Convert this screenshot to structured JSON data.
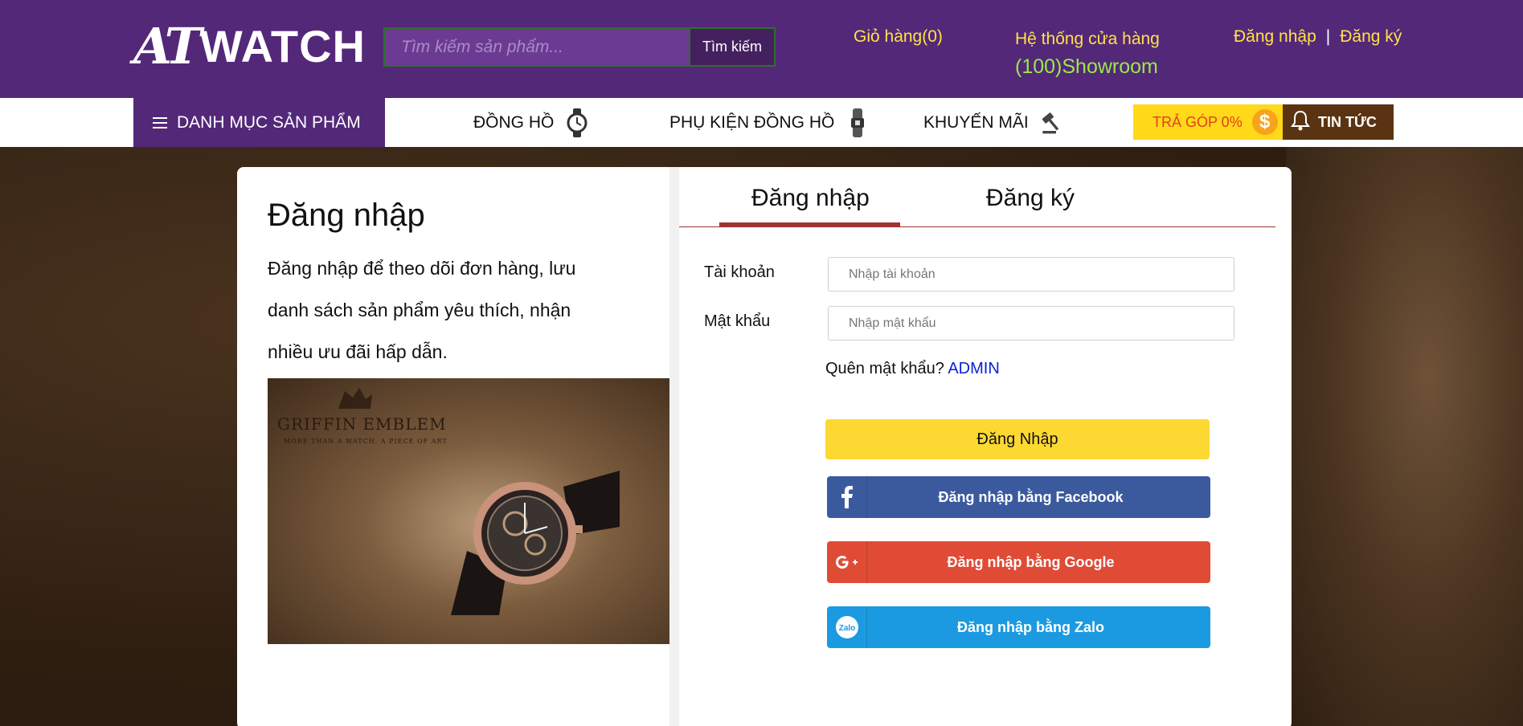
{
  "header": {
    "logo_mark": "AT",
    "logo_text": "WATCH",
    "search_placeholder": "Tìm kiếm sản phẩm...",
    "search_button": "Tìm kiếm",
    "cart": "Giỏ hàng(0)",
    "stores_label": "Hệ thống cửa hàng",
    "stores_count": "(100)Showroom",
    "login_link": "Đăng nhập",
    "separator": "|",
    "register_link": "Đăng ký"
  },
  "nav": {
    "category_menu": "DANH MỤC SẢN PHẨM",
    "items": [
      {
        "label": "ĐỒNG HỒ",
        "icon": "watch-icon"
      },
      {
        "label": "PHỤ KIỆN ĐỒNG HỒ",
        "icon": "watch-strap-icon"
      },
      {
        "label": "KHUYẾN MÃI",
        "icon": "gavel-icon"
      }
    ],
    "installment": "TRẢ GÓP 0%",
    "installment_icon": "dollar-coin-icon",
    "news": "TIN TỨC",
    "news_icon": "bell-icon"
  },
  "left": {
    "title": "Đăng nhập",
    "description": "Đăng nhập để theo dõi đơn hàng, lưu danh sách sản phẩm yêu thích, nhận nhiều ưu đãi hấp dẫn.",
    "image_brand": "GRIFFIN EMBLEM",
    "image_tagline": "MORE THAN A WATCH. A PIECE OF ART"
  },
  "form": {
    "tab_login": "Đăng nhập",
    "tab_register": "Đăng ký",
    "account_label": "Tài khoản",
    "account_placeholder": "Nhập tài khoản",
    "password_label": "Mật khẩu",
    "password_placeholder": "Nhập mật khẩu",
    "forgot_text": "Quên mật khẩu?",
    "forgot_link": "ADMIN",
    "login_button": "Đăng Nhập",
    "facebook_button": "Đăng nhập bằng Facebook",
    "google_button": "Đăng nhập bằng Google",
    "zalo_button": "Đăng nhập bằng Zalo"
  },
  "colors": {
    "brand_purple": "#532879",
    "accent_yellow": "#ffe14a",
    "login_button": "#fcd833",
    "facebook": "#3b5a9e",
    "google": "#e04b36",
    "zalo": "#1b9ae1",
    "tab_accent": "#a0322f"
  }
}
